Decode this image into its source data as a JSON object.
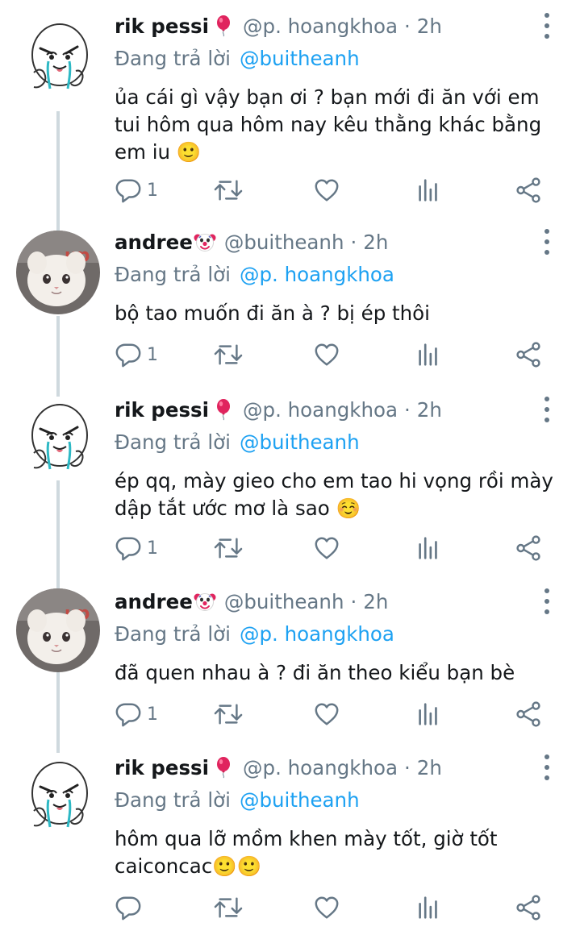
{
  "colors": {
    "accent": "#1da1f2",
    "muted": "#657786",
    "text": "#14171a",
    "thread": "#cfd9de"
  },
  "tweets": [
    {
      "author": "rik pessi",
      "badge_icon": "balloon-icon",
      "handle": "@p. hoangkhoa",
      "separator": "·",
      "time": "2h",
      "reply_prefix": "Đang trả lời",
      "reply_to": "@buitheanh",
      "text": "ủa cái gì vậy bạn ơi ? bạn mới đi ăn với em\ntui hôm qua hôm nay kêu thằng khác bằng\nem iu 🙂",
      "reply_count": "1"
    },
    {
      "author": "andree",
      "badge_icon": "clown-face-icon",
      "handle": "@buitheanh",
      "separator": "·",
      "time": "2h",
      "reply_prefix": "Đang trả lời",
      "reply_to": "@p. hoangkhoa",
      "text": "bộ tao muốn đi ăn à ? bị ép thôi",
      "reply_count": "1"
    },
    {
      "author": "rik pessi",
      "badge_icon": "balloon-icon",
      "handle": "@p. hoangkhoa",
      "separator": "·",
      "time": "2h",
      "reply_prefix": "Đang trả lời",
      "reply_to": "@buitheanh",
      "text": "ép qq, mày gieo cho em tao hi vọng rồi mày\ndập tắt ước mơ là sao ☺️",
      "reply_count": "1"
    },
    {
      "author": "andree",
      "badge_icon": "clown-face-icon",
      "handle": "@buitheanh",
      "separator": "·",
      "time": "2h",
      "reply_prefix": "Đang trả lời",
      "reply_to": "@p. hoangkhoa",
      "text": "đã quen nhau à ? đi ăn theo kiểu bạn bè",
      "reply_count": "1"
    },
    {
      "author": "rik pessi",
      "badge_icon": "balloon-icon",
      "handle": "@p. hoangkhoa",
      "separator": "·",
      "time": "2h",
      "reply_prefix": "Đang trả lời",
      "reply_to": "@buitheanh",
      "text": "hôm qua lỡ mồm khen mày tốt, giờ tốt\ncaiconcac🙂🙂",
      "reply_count": ""
    }
  ]
}
